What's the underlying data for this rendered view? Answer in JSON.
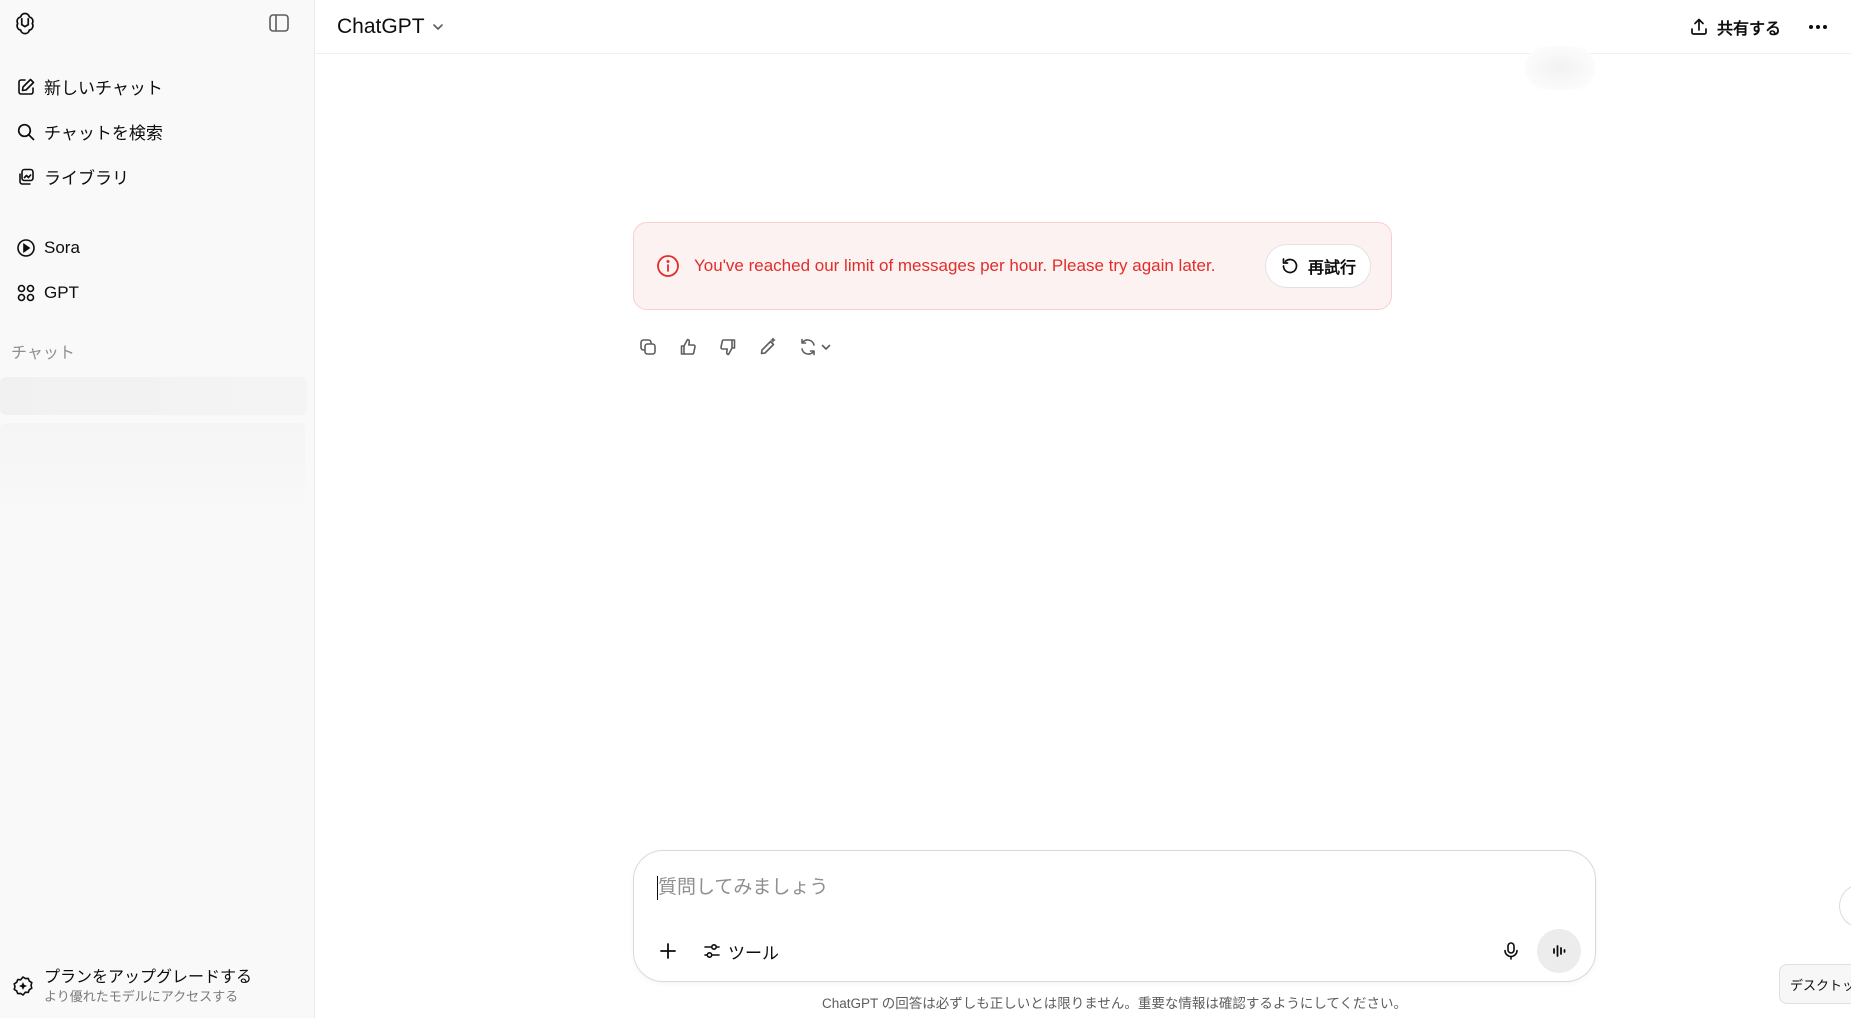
{
  "sidebar": {
    "nav_top": [
      {
        "label": "新しいチャット",
        "icon": "compose-icon"
      },
      {
        "label": "チャットを検索",
        "icon": "search-icon"
      },
      {
        "label": "ライブラリ",
        "icon": "library-icon"
      }
    ],
    "nav_mid": [
      {
        "label": "Sora",
        "icon": "play-circle-icon"
      },
      {
        "label": "GPT",
        "icon": "grid-icon"
      }
    ],
    "section_label": "チャット",
    "upgrade": {
      "title": "プランをアップグレードする",
      "subtitle": "より優れたモデルにアクセスする"
    }
  },
  "header": {
    "model_name": "ChatGPT",
    "share_label": "共有する"
  },
  "error": {
    "message": "You've reached our limit of messages per hour. Please try again later.",
    "retry_label": "再試行",
    "color": "#e02e2a"
  },
  "composer": {
    "placeholder": "質問してみましょう",
    "tools_label": "ツール"
  },
  "disclaimer": "ChatGPT の回答は必ずしも正しいとは限りません。重要な情報は確認するようにしてください。",
  "desktop_tab_label": "デスクトップ"
}
